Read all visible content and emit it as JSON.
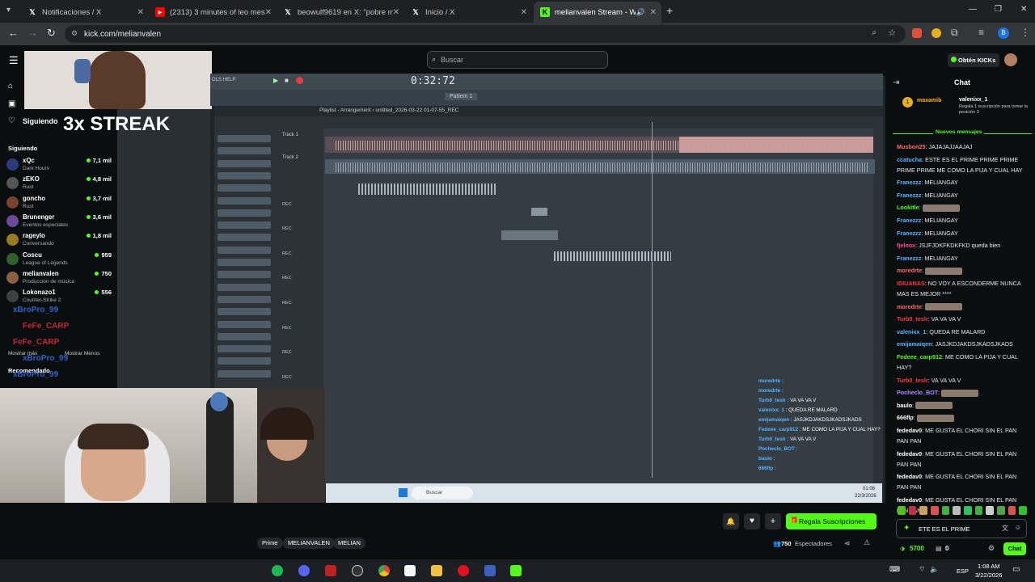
{
  "tabs": [
    {
      "label": "Notificaciones / X",
      "icon": "x-icon"
    },
    {
      "label": "(2313) 3 minutes of leo messi a",
      "icon": "youtube-icon"
    },
    {
      "label": "beowulf9619 en X: \"pobre marg",
      "icon": "x-icon"
    },
    {
      "label": "Inicio / X",
      "icon": "x-icon"
    },
    {
      "label": "melianvalen Stream - Watch",
      "icon": "kick-icon"
    }
  ],
  "address": "kick.com/melianvalen",
  "search_placeholder": "Buscar",
  "obtain_kicks": "Obtén KICKs",
  "sidebar": {
    "siguiendo_header": "Siguiendo",
    "siguiendo_label": "Siguiendo",
    "channels": [
      {
        "name": "xQc",
        "category": "Dark Hours",
        "viewers": "7,1 mil",
        "color": "#2a3a7a"
      },
      {
        "name": "zEKO",
        "category": "Rust",
        "viewers": "4,8 mil",
        "color": "#555"
      },
      {
        "name": "goncho",
        "category": "Rust",
        "viewers": "3,7 mil",
        "color": "#7a4030"
      },
      {
        "name": "Brunenger",
        "category": "Eventos especiales",
        "viewers": "3,6 mil",
        "color": "#6a4a9a"
      },
      {
        "name": "rageylo",
        "category": "Conversando",
        "viewers": "1,8 mil",
        "color": "#9a7a20"
      },
      {
        "name": "Coscu",
        "category": "League of Legends",
        "viewers": "959",
        "color": "#306030"
      },
      {
        "name": "melianvalen",
        "category": "Producción de música",
        "viewers": "750",
        "color": "#8a6040"
      },
      {
        "name": "Lokonazo1",
        "category": "Counter-Strike 2",
        "viewers": "556",
        "color": "#404040"
      }
    ],
    "mostrar_mas": "Mostrar más",
    "mostrar_menos": "Mostrar Menos",
    "recomendado": "Recomendado"
  },
  "stream_overlay": {
    "streak": "3x STREAK",
    "playlist_title": "Playlist - Arrangement › untitled_2026-03-22 01-07-55_REC",
    "time": "0:32:72",
    "pattern": "Pattern 1",
    "track1": "Track 1",
    "track2": "Track 2",
    "rec": "REC",
    "overlay_chat": [
      {
        "u": "moredrte",
        "t": ""
      },
      {
        "u": "moredrte",
        "t": ""
      },
      {
        "u": "Turb0_teslr",
        "t": "VA VA VA V"
      },
      {
        "u": "valenixx_1",
        "t": "QUEDA RE MALARD"
      },
      {
        "u": "emijamaiqen",
        "t": "JASJKDJAKDSJKADSJKADS"
      },
      {
        "u": "Fedeee_carp912",
        "t": "ME COMO LA PIJA Y CUAL HAY?"
      },
      {
        "u": "Turb0_teslr",
        "t": "VA VA VA V"
      },
      {
        "u": "Pocheclo_BOT",
        "t": ""
      },
      {
        "u": "baulo",
        "t": ""
      },
      {
        "u": "666flp",
        "t": ""
      }
    ],
    "taskbar_search": "Buscar",
    "clock": "01:08",
    "date": "22/3/2026",
    "ghost": [
      {
        "t": "xBroPro_99"
      },
      {
        "t": "FeFe_CARP"
      },
      {
        "t": "FeFe_CARP"
      },
      {
        "t": "xBroPro_99"
      },
      {
        "t": "xBroPro_99"
      }
    ]
  },
  "chat": {
    "title": "Chat",
    "pinned_user": "maxamib",
    "pinned_user2": "valenixx_1",
    "pinned_text": "Regala 1 suscripción para tomar la posición 3",
    "new_messages": "Nuevos mensajes",
    "messages": [
      {
        "u": "Musbon25",
        "c": "#ff6b6b",
        "t": "JAJAJAJJAAJAJ"
      },
      {
        "u": "ccatucha",
        "c": "#5ab4ff",
        "t": "ESTE ES EL PRIME PRIME PRIME PRIME PRIME ME COMO LA PIJA Y CUAL HAY"
      },
      {
        "u": "Franezzz",
        "c": "#5ab4ff",
        "t": "MELIANGAY"
      },
      {
        "u": "Franezzz",
        "c": "#5ab4ff",
        "t": "MELIANGAY"
      },
      {
        "u": "Lookitle",
        "c": "#53fc18",
        "t": ""
      },
      {
        "u": "Franezzz",
        "c": "#5ab4ff",
        "t": "MELIANGAY"
      },
      {
        "u": "Franezzz",
        "c": "#5ab4ff",
        "t": "MELIANGAY"
      },
      {
        "u": "fjelnox",
        "c": "#ff4f8b",
        "t": "JSJFJDKFKDKFKD queda bien"
      },
      {
        "u": "Franezzz",
        "c": "#5ab4ff",
        "t": "MELIANGAY"
      },
      {
        "u": "moredrte",
        "c": "#ff6b6b",
        "t": ""
      },
      {
        "u": "IDIUANAS",
        "c": "#ff3b3b",
        "t": "NO VOY A ESCONDERME NUNCA MAS ES MEJOR ****"
      },
      {
        "u": "moredrte",
        "c": "#ff6b6b",
        "t": ""
      },
      {
        "u": "Turb0_teslr",
        "c": "#ff3b3b",
        "t": "VA VA VA V"
      },
      {
        "u": "valenixx_1",
        "c": "#5ab4ff",
        "t": "QUEDA RE MALARD"
      },
      {
        "u": "emijamaiqen",
        "c": "#5ab4ff",
        "t": "JASJKDJAKDSJKADSJKADS"
      },
      {
        "u": "Fedeee_carp912",
        "c": "#53fc18",
        "t": "ME COMO LA PIJA Y CUAL HAY?"
      },
      {
        "u": "Turb0_teslr",
        "c": "#ff3b3b",
        "t": "VA VA VA V"
      },
      {
        "u": "Pocheclo_BOT",
        "c": "#b28cff",
        "t": ""
      },
      {
        "u": "baulo",
        "c": "#fff",
        "t": ""
      },
      {
        "u": "666flp",
        "c": "#fff",
        "t": ""
      },
      {
        "u": "fededav0",
        "c": "#fff",
        "t": "ME GUSTA EL CHORI SIN EL PAN PAN PAN"
      },
      {
        "u": "fededav0",
        "c": "#fff",
        "t": "ME GUSTA EL CHORI SIN EL PAN PAN PAN"
      },
      {
        "u": "fededav0",
        "c": "#fff",
        "t": "ME GUSTA EL CHORI SIN EL PAN PAN PAN"
      },
      {
        "u": "fededav0",
        "c": "#fff",
        "t": "ME GUSTA EL CHORI SIN EL PAN PAN PAN"
      }
    ],
    "input_value": "ETE ES EL PRIME",
    "kicks": "5700",
    "gifts": "0",
    "send": "Chat"
  },
  "player": {
    "subscribe": "Regala Suscripciones",
    "viewers": "750",
    "viewers_label": "Espectadores",
    "tags": [
      "Prime",
      "MELIANVALEN",
      "MELIAN"
    ]
  },
  "os": {
    "lang": "ESP",
    "time": "1:08 AM",
    "date": "3/22/2026"
  }
}
